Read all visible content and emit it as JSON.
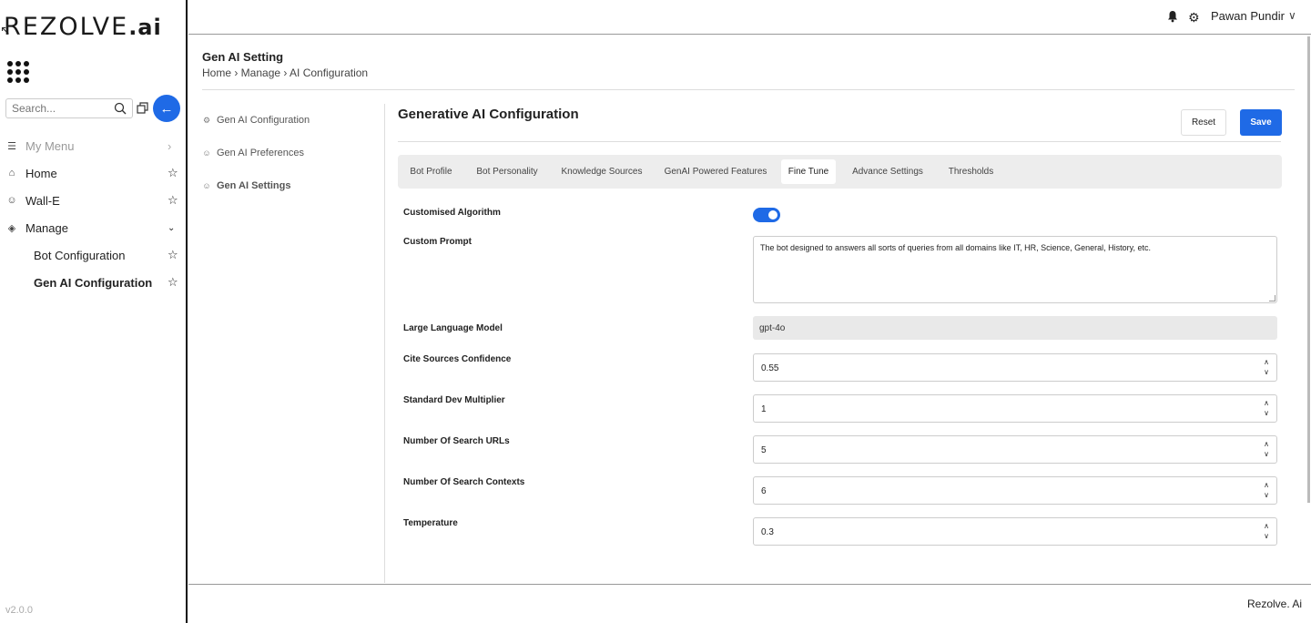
{
  "sidebar": {
    "logo_text": "REZOLVE",
    "logo_ai": ".ai",
    "search_placeholder": "Search...",
    "menu": [
      {
        "label": "My Menu"
      },
      {
        "label": "Home"
      },
      {
        "label": "Wall-E"
      },
      {
        "label": "Manage"
      },
      {
        "label": "Bot Configuration"
      },
      {
        "label": "Gen AI Configuration"
      }
    ],
    "version": "v2.0.0"
  },
  "header": {
    "user_name": "Pawan Pundir"
  },
  "page": {
    "title": "Gen AI Setting",
    "breadcrumb": "Home › Manage › AI Configuration"
  },
  "subnav": [
    {
      "label": "Gen AI Configuration"
    },
    {
      "label": "Gen AI Preferences"
    },
    {
      "label": "Gen AI Settings"
    }
  ],
  "content": {
    "section_title": "Generative AI Configuration",
    "reset_label": "Reset",
    "save_label": "Save",
    "tabs": [
      {
        "label": "Bot Profile"
      },
      {
        "label": "Bot Personality"
      },
      {
        "label": "Knowledge Sources"
      },
      {
        "label": "GenAI Powered Features"
      },
      {
        "label": "Fine Tune"
      },
      {
        "label": "Advance Settings"
      },
      {
        "label": "Thresholds"
      }
    ],
    "active_tab": "Fine Tune",
    "fields": {
      "customised_algorithm": {
        "label": "Customised Algorithm",
        "enabled": true
      },
      "custom_prompt": {
        "label": "Custom Prompt",
        "value": "The bot designed to answers all sorts of queries from all domains like IT, HR, Science, General, History, etc."
      },
      "llm": {
        "label": "Large Language Model",
        "value": "gpt-4o"
      },
      "cite_sources_confidence": {
        "label": "Cite Sources Confidence",
        "value": "0.55"
      },
      "std_dev_multiplier": {
        "label": "Standard Dev Multiplier",
        "value": "1"
      },
      "num_search_urls": {
        "label": "Number Of Search URLs",
        "value": "5"
      },
      "num_search_contexts": {
        "label": "Number Of Search Contexts",
        "value": "6"
      },
      "temperature": {
        "label": "Temperature",
        "value": "0.3"
      }
    }
  },
  "footer": {
    "text": "Rezolve. Ai"
  },
  "colors": {
    "accent": "#1f6ae6",
    "logo_check": "#49a52f"
  }
}
